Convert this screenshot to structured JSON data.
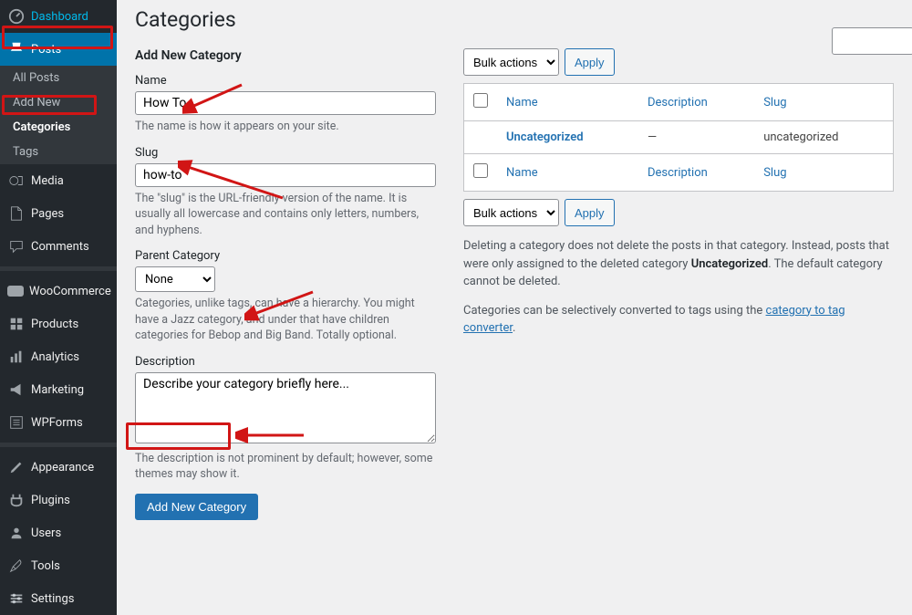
{
  "sidebar": {
    "items": [
      {
        "label": "Dashboard",
        "icon": "dashboard"
      },
      {
        "label": "Posts",
        "icon": "pin",
        "active": true,
        "children": [
          {
            "label": "All Posts"
          },
          {
            "label": "Add New"
          },
          {
            "label": "Categories",
            "current": true
          },
          {
            "label": "Tags"
          }
        ]
      },
      {
        "label": "Media",
        "icon": "media"
      },
      {
        "label": "Pages",
        "icon": "page"
      },
      {
        "label": "Comments",
        "icon": "comment"
      },
      {
        "label": "WooCommerce",
        "icon": "woo"
      },
      {
        "label": "Products",
        "icon": "products"
      },
      {
        "label": "Analytics",
        "icon": "analytics"
      },
      {
        "label": "Marketing",
        "icon": "marketing"
      },
      {
        "label": "WPForms",
        "icon": "wpforms"
      },
      {
        "label": "Appearance",
        "icon": "appearance"
      },
      {
        "label": "Plugins",
        "icon": "plugins"
      },
      {
        "label": "Users",
        "icon": "users"
      },
      {
        "label": "Tools",
        "icon": "tools"
      },
      {
        "label": "Settings",
        "icon": "settings"
      }
    ]
  },
  "page": {
    "title": "Categories"
  },
  "form": {
    "heading": "Add New Category",
    "name_label": "Name",
    "name_value": "How To",
    "name_desc": "The name is how it appears on your site.",
    "slug_label": "Slug",
    "slug_value": "how-to",
    "slug_desc": "The \"slug\" is the URL-friendly version of the name. It is usually all lowercase and contains only letters, numbers, and hyphens.",
    "parent_label": "Parent Category",
    "parent_value": "None",
    "parent_desc": "Categories, unlike tags, can have a hierarchy. You might have a Jazz category, and under that have children categories for Bebop and Big Band. Totally optional.",
    "desc_label": "Description",
    "desc_value": "Describe your category briefly here...",
    "desc_desc": "The description is not prominent by default; however, some themes may show it.",
    "submit": "Add New Category"
  },
  "table": {
    "bulk_label": "Bulk actions",
    "apply": "Apply",
    "headers": {
      "name": "Name",
      "desc": "Description",
      "slug": "Slug"
    },
    "rows": [
      {
        "name": "Uncategorized",
        "desc": "—",
        "slug": "uncategorized"
      }
    ]
  },
  "notes": {
    "p1a": "Deleting a category does not delete the posts in that category. Instead, posts that were only assigned to the deleted category ",
    "p1b": "Uncategorized",
    "p1c": ". The default category cannot be deleted.",
    "p2a": "Categories can be selectively converted to tags using the ",
    "p2link": "category to tag converter",
    "p2b": "."
  }
}
